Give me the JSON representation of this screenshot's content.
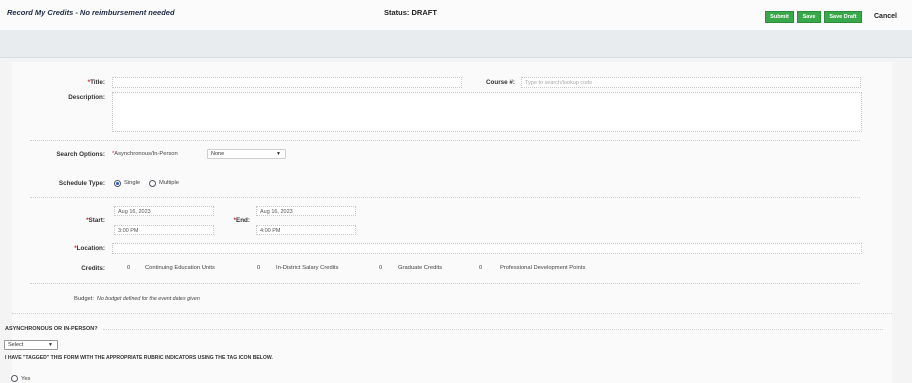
{
  "header": {
    "left_title": "Record My Credits - No reimbursement needed",
    "status": "Status: DRAFT",
    "buttons": {
      "submit": "Submit",
      "save": "Save",
      "save_draft": "Save Draft",
      "cancel": "Cancel"
    }
  },
  "form": {
    "title_label": "Title:",
    "course_label": "Course #:",
    "course_placeholder": "Type to search/lookup code",
    "description_label": "Description:",
    "search_options_label": "Search Options:",
    "search_options_field_label": "Asynchronous/In-Person",
    "search_options_value": "None",
    "schedule_type_label": "Schedule Type:",
    "schedule_options": [
      "Single",
      "Multiple"
    ],
    "start_label": "Start:",
    "end_label": "End:",
    "start_date": "Aug 16, 2023",
    "start_time": "3:00 PM",
    "end_date": "Aug 16, 2023",
    "end_time": "4:00 PM",
    "location_label": "Location:",
    "credits_label": "Credits:",
    "credits": [
      {
        "value": "0",
        "label": "Continuing Education Units"
      },
      {
        "value": "0",
        "label": "In-District Salary Credits"
      },
      {
        "value": "0",
        "label": "Graduate Credits"
      },
      {
        "value": "0",
        "label": "Professional Development Points"
      }
    ],
    "budget_label": "Budget:",
    "budget_text": "No budget defined for the event dates given"
  },
  "lower": {
    "async_question": "ASYNCHRONOUS OR IN-PERSON?",
    "select_value": "Select",
    "tag_statement": "I HAVE \"TAGGED\" THIS FORM WITH THE APPROPRIATE RUBRIC INDICATORS USING THE TAG ICON BELOW.",
    "yes_option": "Yes"
  }
}
